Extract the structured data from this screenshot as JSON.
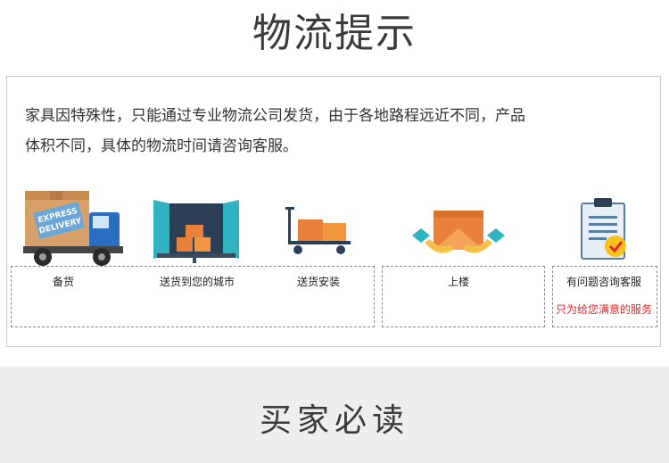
{
  "header": {
    "title": "物流提示"
  },
  "notice": {
    "line1": "家具因特殊性，只能通过专业物流公司发货，由于各地路程远近不同，产品",
    "line2": "体积不同，具体的物流时间请咨询客服。"
  },
  "truck": {
    "label_line1": "EXPRESS",
    "label_line2": "DELIVERY"
  },
  "steps": [
    {
      "label": "备货",
      "icon": "delivery-truck-icon"
    },
    {
      "label": "送货到您的城市",
      "icon": "cargo-van-boxes-icon"
    },
    {
      "label": "送货安装",
      "icon": "hand-cart-icon"
    },
    {
      "label": "上楼",
      "icon": "hands-carrying-box-icon"
    },
    {
      "label": "有问题咨询客服",
      "icon": "checklist-clipboard-icon"
    }
  ],
  "promo": "只为给您满意的服务",
  "colors": {
    "accent_orange": "#e8823a",
    "teal": "#2fb3c0",
    "promo_red": "#e4262a"
  },
  "section": {
    "title": "买家必读"
  }
}
